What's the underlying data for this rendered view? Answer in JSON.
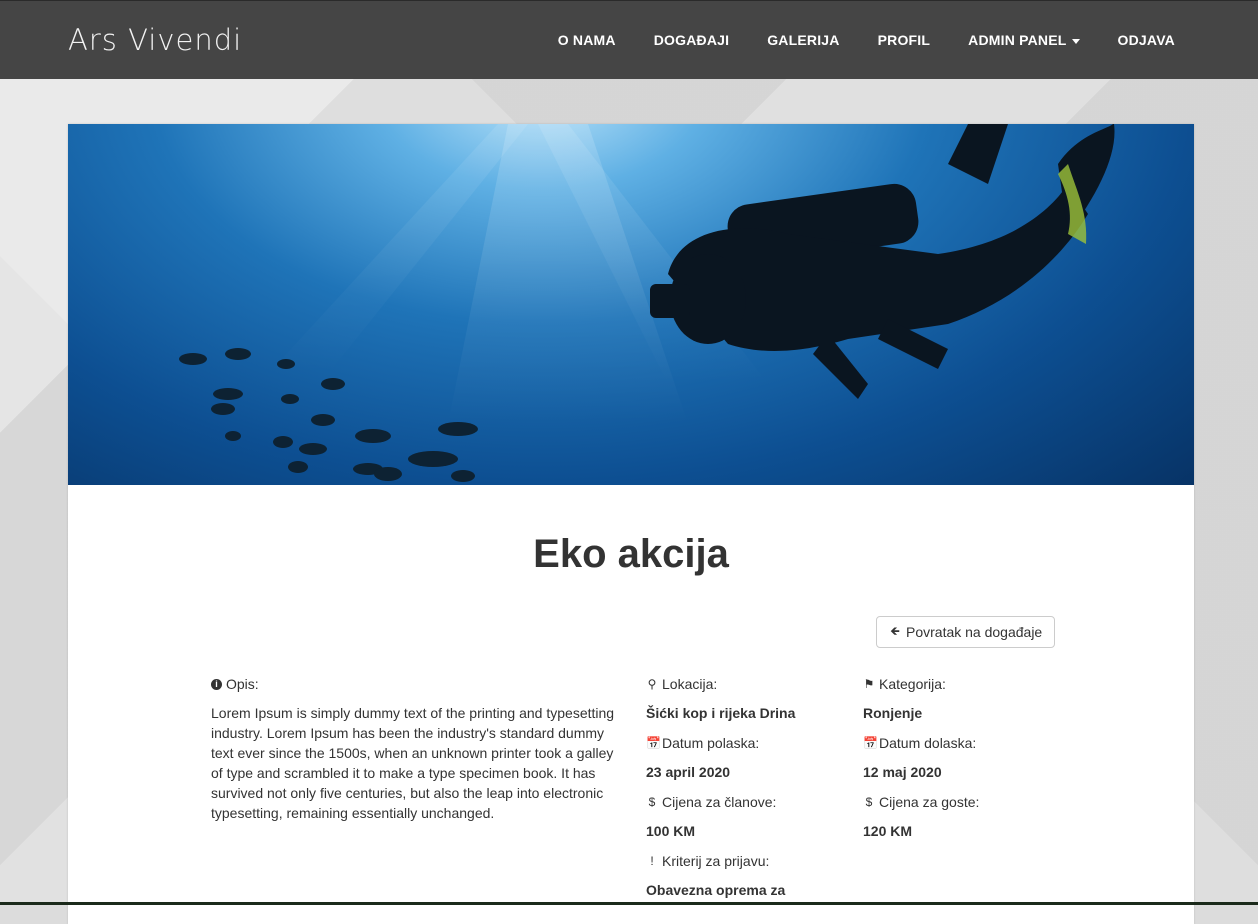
{
  "brand": "Ars Vivendi",
  "nav": {
    "items": [
      "O NAMA",
      "DOGAĐAJI",
      "GALERIJA",
      "PROFIL"
    ],
    "admin": "ADMIN PANEL",
    "logout": "ODJAVA"
  },
  "event": {
    "title": "Eko akcija",
    "back_label": "Povratak na događaje",
    "description_label": "Opis:",
    "description": "Lorem Ipsum is simply dummy text of the printing and typesetting industry. Lorem Ipsum has been the industry's standard dummy text ever since the 1500s, when an unknown printer took a galley of type and scrambled it to make a type specimen book. It has survived not only five centuries, but also the leap into electronic typesetting, remaining essentially unchanged.",
    "location_label": "Lokacija:",
    "location": "Šićki kop i rijeka Drina",
    "category_label": "Kategorija:",
    "category": "Ronjenje",
    "departure_label": "Datum polaska:",
    "departure": "23 april 2020",
    "arrival_label": "Datum dolaska:",
    "arrival": "12 maj 2020",
    "member_price_label": "Cijena za članove:",
    "member_price": "100 KM",
    "guest_price_label": "Cijena za goste:",
    "guest_price": "120 KM",
    "criteria_label": "Kriterij za prijavu:",
    "criteria": "Obavezna oprema za"
  },
  "icons": {
    "info": "info-icon",
    "location": "map-marker-icon",
    "category": "tag-icon",
    "calendar": "calendar-icon",
    "price": "dollar-icon",
    "criteria": "exclamation-icon",
    "back": "arrow-left-icon"
  },
  "colors": {
    "navbar": "#454545",
    "text": "#333333",
    "water_light": "#5fb0e4",
    "water_dark": "#073366"
  }
}
